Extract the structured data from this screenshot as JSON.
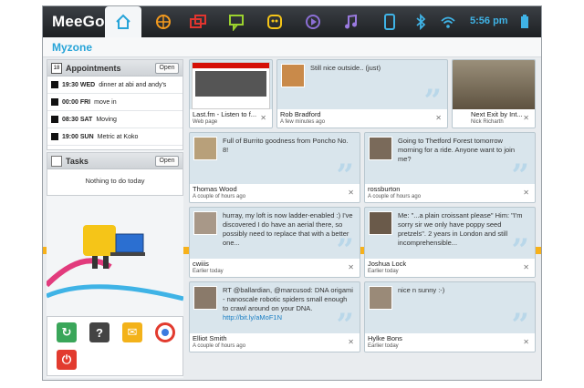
{
  "topbar": {
    "logo": "MeeGo",
    "clock": "5:56 pm",
    "icons": [
      "home-icon",
      "network-icon",
      "multitask-icon",
      "chat-icon",
      "people-icon",
      "media-icon",
      "music-icon",
      "device-icon",
      "bluetooth-icon",
      "wifi-icon",
      "battery-icon"
    ]
  },
  "zone": {
    "title": "Myzone"
  },
  "appointments": {
    "calendar_day": "18",
    "title": "Appointments",
    "open": "Open",
    "items": [
      {
        "time": "19:30 WED",
        "text": "dinner at abi and andy's"
      },
      {
        "time": "00:00 FRI",
        "text": "move in"
      },
      {
        "time": "08:30 SAT",
        "text": "Moving"
      },
      {
        "time": "19:00 SUN",
        "text": "Metric at Koko"
      }
    ]
  },
  "tasks": {
    "title": "Tasks",
    "open": "Open",
    "empty": "Nothing to do today"
  },
  "apps": [
    "restore-icon",
    "help-icon",
    "mail-icon",
    "chrome-icon",
    "shutdown-icon"
  ],
  "cards": [
    {
      "author": "Last.fm - Listen to f...",
      "when": "Web page",
      "msg": ""
    },
    {
      "author": "Rob Bradford",
      "when": "A few minutes ago",
      "msg": "Still nice outside.. (just)"
    },
    {
      "author": "Next Exit by Int...",
      "when": "Nick Richarth",
      "msg": ""
    },
    {
      "author": "Thomas Wood",
      "when": "A couple of hours ago",
      "msg": "Full of Burrito goodness from Poncho No. 8!"
    },
    {
      "author": "rossburton",
      "when": "A couple of hours ago",
      "msg": "Going to Thetford Forest tomorrow morning for a ride. Anyone want to join me?"
    },
    {
      "author": "cwiiis",
      "when": "Earlier today",
      "msg": "hurray, my loft is now ladder-enabled :) I've discovered I do have an aerial there, so possibly need to replace that with a better one..."
    },
    {
      "author": "Joshua Lock",
      "when": "Earlier today",
      "msg": "Me: \"...a plain croissant please\" Him: \"I'm sorry sir we only have poppy seed pretzels\". 2 years in London and still incomprehensible..."
    },
    {
      "author": "Elliot Smith",
      "when": "A couple of hours ago",
      "msg": "RT @ballardian, @marcusod: DNA origami - nanoscale robotic spiders small enough to crawl around on your DNA. ",
      "link": "http://bit.ly/aMoF1N"
    },
    {
      "author": "Hylke Bons",
      "when": "Earlier today",
      "msg": "nice n sunny :-)"
    }
  ],
  "colors": {
    "accent": "#27a4d8",
    "topbar": "#25282c",
    "card": "#d9e5ec",
    "band": "#f7b11a"
  }
}
